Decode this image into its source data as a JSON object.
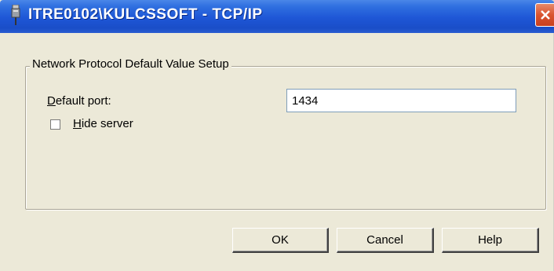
{
  "window": {
    "title": "ITRE0102\\KULCSSOFT - TCP/IP",
    "title_icon": "network-plug-icon",
    "close_icon": "close-icon"
  },
  "group": {
    "legend": "Network Protocol Default Value Setup"
  },
  "default_port": {
    "label_accel": "D",
    "label_rest": "efault port:",
    "value": "1434"
  },
  "hide_server": {
    "label_accel": "H",
    "label_rest": "ide server",
    "checked": false
  },
  "buttons": {
    "ok": "OK",
    "cancel": "Cancel",
    "help": "Help"
  },
  "colors": {
    "titlebar": "#1e56d6",
    "close": "#d9532f",
    "face": "#ece9d8"
  }
}
